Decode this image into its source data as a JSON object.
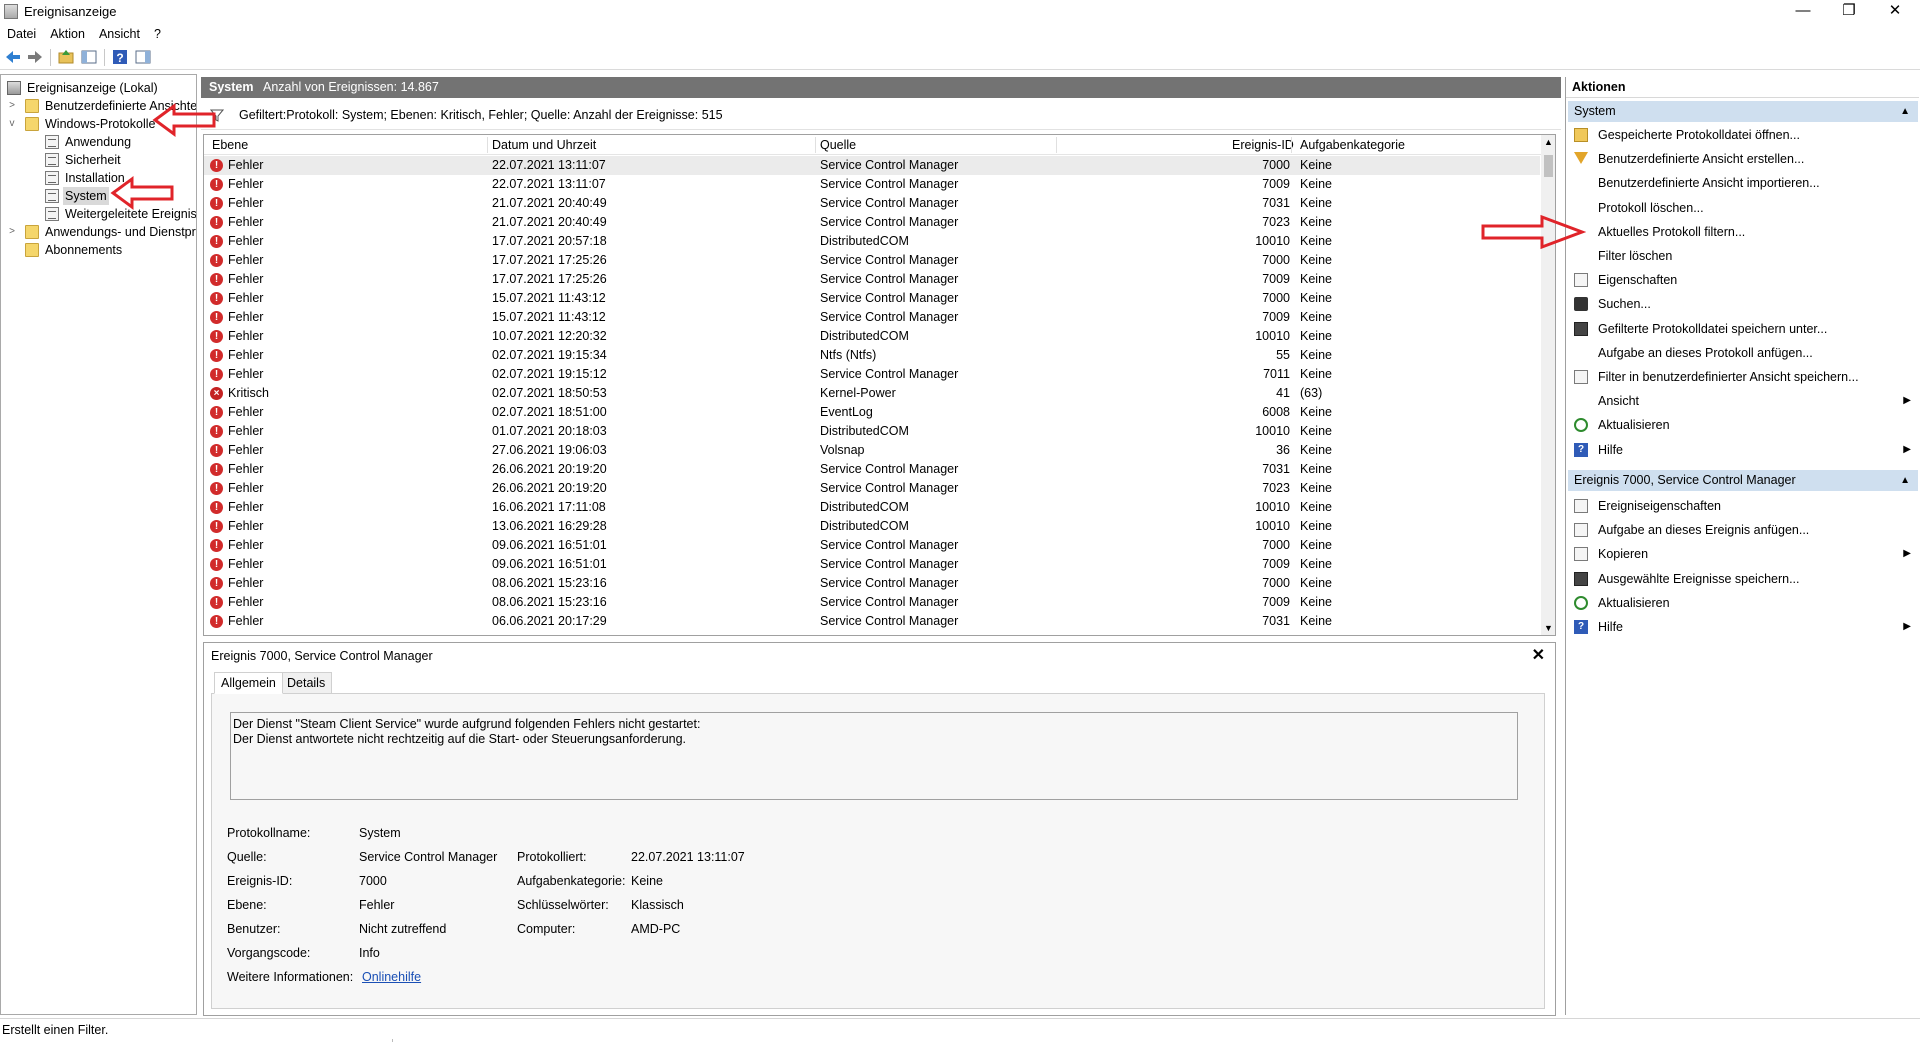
{
  "window": {
    "title": "Ereignisanzeige",
    "minimize_glyph": "—",
    "restore_glyph": "❐",
    "close_glyph": "✕"
  },
  "menu": [
    "Datei",
    "Aktion",
    "Ansicht",
    "?"
  ],
  "toolbar_icons": [
    "back-arrow-icon",
    "forward-arrow-icon",
    "up-folder-icon",
    "show-hide-tree-icon",
    "help-icon",
    "show-hide-action-pane-icon"
  ],
  "tree": {
    "root": "Ereignisanzeige (Lokal)",
    "custom_views": "Benutzerdefinierte Ansichten",
    "windows_logs": "Windows-Protokolle",
    "logs": [
      "Anwendung",
      "Sicherheit",
      "Installation",
      "System",
      "Weitergeleitete Ereignisse"
    ],
    "app_services": "Anwendungs- und Dienstprotokolle",
    "subscriptions": "Abonnements"
  },
  "center": {
    "log_name": "System",
    "event_count": "Anzahl von Ereignissen: 14.867",
    "filter_text": "Gefiltert:Protokoll: System; Ebenen: Kritisch, Fehler; Quelle:  Anzahl der Ereignisse: 515"
  },
  "events_table": {
    "columns": [
      "Ebene",
      "Datum und Uhrzeit",
      "Quelle",
      "Ereignis-ID",
      "Aufgabenkategorie"
    ],
    "rows": [
      {
        "level": "Fehler",
        "date": "22.07.2021 13:11:07",
        "source": "Service Control Manager",
        "id": "7000",
        "category": "Keine"
      },
      {
        "level": "Fehler",
        "date": "22.07.2021 13:11:07",
        "source": "Service Control Manager",
        "id": "7009",
        "category": "Keine"
      },
      {
        "level": "Fehler",
        "date": "21.07.2021 20:40:49",
        "source": "Service Control Manager",
        "id": "7031",
        "category": "Keine"
      },
      {
        "level": "Fehler",
        "date": "21.07.2021 20:40:49",
        "source": "Service Control Manager",
        "id": "7023",
        "category": "Keine"
      },
      {
        "level": "Fehler",
        "date": "17.07.2021 20:57:18",
        "source": "DistributedCOM",
        "id": "10010",
        "category": "Keine"
      },
      {
        "level": "Fehler",
        "date": "17.07.2021 17:25:26",
        "source": "Service Control Manager",
        "id": "7000",
        "category": "Keine"
      },
      {
        "level": "Fehler",
        "date": "17.07.2021 17:25:26",
        "source": "Service Control Manager",
        "id": "7009",
        "category": "Keine"
      },
      {
        "level": "Fehler",
        "date": "15.07.2021 11:43:12",
        "source": "Service Control Manager",
        "id": "7000",
        "category": "Keine"
      },
      {
        "level": "Fehler",
        "date": "15.07.2021 11:43:12",
        "source": "Service Control Manager",
        "id": "7009",
        "category": "Keine"
      },
      {
        "level": "Fehler",
        "date": "10.07.2021 12:20:32",
        "source": "DistributedCOM",
        "id": "10010",
        "category": "Keine"
      },
      {
        "level": "Fehler",
        "date": "02.07.2021 19:15:34",
        "source": "Ntfs (Ntfs)",
        "id": "55",
        "category": "Keine"
      },
      {
        "level": "Fehler",
        "date": "02.07.2021 19:15:12",
        "source": "Service Control Manager",
        "id": "7011",
        "category": "Keine"
      },
      {
        "level": "Kritisch",
        "date": "02.07.2021 18:50:53",
        "source": "Kernel-Power",
        "id": "41",
        "category": "(63)"
      },
      {
        "level": "Fehler",
        "date": "02.07.2021 18:51:00",
        "source": "EventLog",
        "id": "6008",
        "category": "Keine"
      },
      {
        "level": "Fehler",
        "date": "01.07.2021 20:18:03",
        "source": "DistributedCOM",
        "id": "10010",
        "category": "Keine"
      },
      {
        "level": "Fehler",
        "date": "27.06.2021 19:06:03",
        "source": "Volsnap",
        "id": "36",
        "category": "Keine"
      },
      {
        "level": "Fehler",
        "date": "26.06.2021 20:19:20",
        "source": "Service Control Manager",
        "id": "7031",
        "category": "Keine"
      },
      {
        "level": "Fehler",
        "date": "26.06.2021 20:19:20",
        "source": "Service Control Manager",
        "id": "7023",
        "category": "Keine"
      },
      {
        "level": "Fehler",
        "date": "16.06.2021 17:11:08",
        "source": "DistributedCOM",
        "id": "10010",
        "category": "Keine"
      },
      {
        "level": "Fehler",
        "date": "13.06.2021 16:29:28",
        "source": "DistributedCOM",
        "id": "10010",
        "category": "Keine"
      },
      {
        "level": "Fehler",
        "date": "09.06.2021 16:51:01",
        "source": "Service Control Manager",
        "id": "7000",
        "category": "Keine"
      },
      {
        "level": "Fehler",
        "date": "09.06.2021 16:51:01",
        "source": "Service Control Manager",
        "id": "7009",
        "category": "Keine"
      },
      {
        "level": "Fehler",
        "date": "08.06.2021 15:23:16",
        "source": "Service Control Manager",
        "id": "7000",
        "category": "Keine"
      },
      {
        "level": "Fehler",
        "date": "08.06.2021 15:23:16",
        "source": "Service Control Manager",
        "id": "7009",
        "category": "Keine"
      },
      {
        "level": "Fehler",
        "date": "06.06.2021 20:17:29",
        "source": "Service Control Manager",
        "id": "7031",
        "category": "Keine"
      }
    ]
  },
  "detail": {
    "title": "Ereignis 7000, Service Control Manager",
    "close_glyph": "✕",
    "tabs": [
      "Allgemein",
      "Details"
    ],
    "message_line1": "Der Dienst \"Steam Client Service\" wurde aufgrund folgenden Fehlers nicht gestartet:",
    "message_line2": "Der Dienst antwortete nicht rechtzeitig auf die Start- oder Steuerungsanforderung.",
    "labels": {
      "log_name": "Protokollname:",
      "source": "Quelle:",
      "event_id": "Ereignis-ID:",
      "level": "Ebene:",
      "user": "Benutzer:",
      "opcode": "Vorgangscode:",
      "more_info": "Weitere Informationen:",
      "logged": "Protokolliert:",
      "task_category": "Aufgabenkategorie:",
      "keywords": "Schlüsselwörter:",
      "computer": "Computer:"
    },
    "values": {
      "log_name": "System",
      "source": "Service Control Manager",
      "event_id": "7000",
      "level": "Fehler",
      "user": "Nicht zutreffend",
      "opcode": "Info",
      "more_info_link": "Onlinehilfe",
      "logged": "22.07.2021 13:11:07",
      "task_category": "Keine",
      "keywords": "Klassisch",
      "computer": "AMD-PC"
    }
  },
  "actions": {
    "header": "Aktionen",
    "section1": {
      "title": "System",
      "items": [
        {
          "label": "Gespeicherte Protokolldatei öffnen...",
          "icon": "open-folder-icon"
        },
        {
          "label": "Benutzerdefinierte Ansicht erstellen...",
          "icon": "funnel-icon"
        },
        {
          "label": "Benutzerdefinierte Ansicht importieren...",
          "icon": ""
        },
        {
          "label": "Protokoll löschen...",
          "icon": ""
        },
        {
          "label": "Aktuelles Protokoll filtern...",
          "icon": ""
        },
        {
          "label": "Filter löschen",
          "icon": ""
        },
        {
          "label": "Eigenschaften",
          "icon": "properties-icon"
        },
        {
          "label": "Suchen...",
          "icon": "binoculars-icon"
        },
        {
          "label": "Gefilterte Protokolldatei speichern unter...",
          "icon": "save-icon"
        },
        {
          "label": "Aufgabe an dieses Protokoll anfügen...",
          "icon": ""
        },
        {
          "label": "Filter in benutzerdefinierter Ansicht speichern...",
          "icon": "filter-save-icon"
        },
        {
          "label": "Ansicht",
          "icon": "",
          "submenu": true
        },
        {
          "label": "Aktualisieren",
          "icon": "refresh-icon"
        },
        {
          "label": "Hilfe",
          "icon": "help-icon",
          "submenu": true
        }
      ]
    },
    "section2": {
      "title": "Ereignis 7000, Service Control Manager",
      "items": [
        {
          "label": "Ereigniseigenschaften",
          "icon": "properties-icon"
        },
        {
          "label": "Aufgabe an dieses Ereignis anfügen...",
          "icon": "task-icon"
        },
        {
          "label": "Kopieren",
          "icon": "copy-icon",
          "submenu": true
        },
        {
          "label": "Ausgewählte Ereignisse speichern...",
          "icon": "save-icon"
        },
        {
          "label": "Aktualisieren",
          "icon": "refresh-icon"
        },
        {
          "label": "Hilfe",
          "icon": "help-icon",
          "submenu": true
        }
      ]
    }
  },
  "status_bar": "Erstellt einen Filter.",
  "colors": {
    "annotation_arrow": "#e0242a",
    "header_bar": "#737373",
    "section_header": "#cfdfef",
    "error_icon": "#d12b2b",
    "link": "#1a4fb5"
  }
}
